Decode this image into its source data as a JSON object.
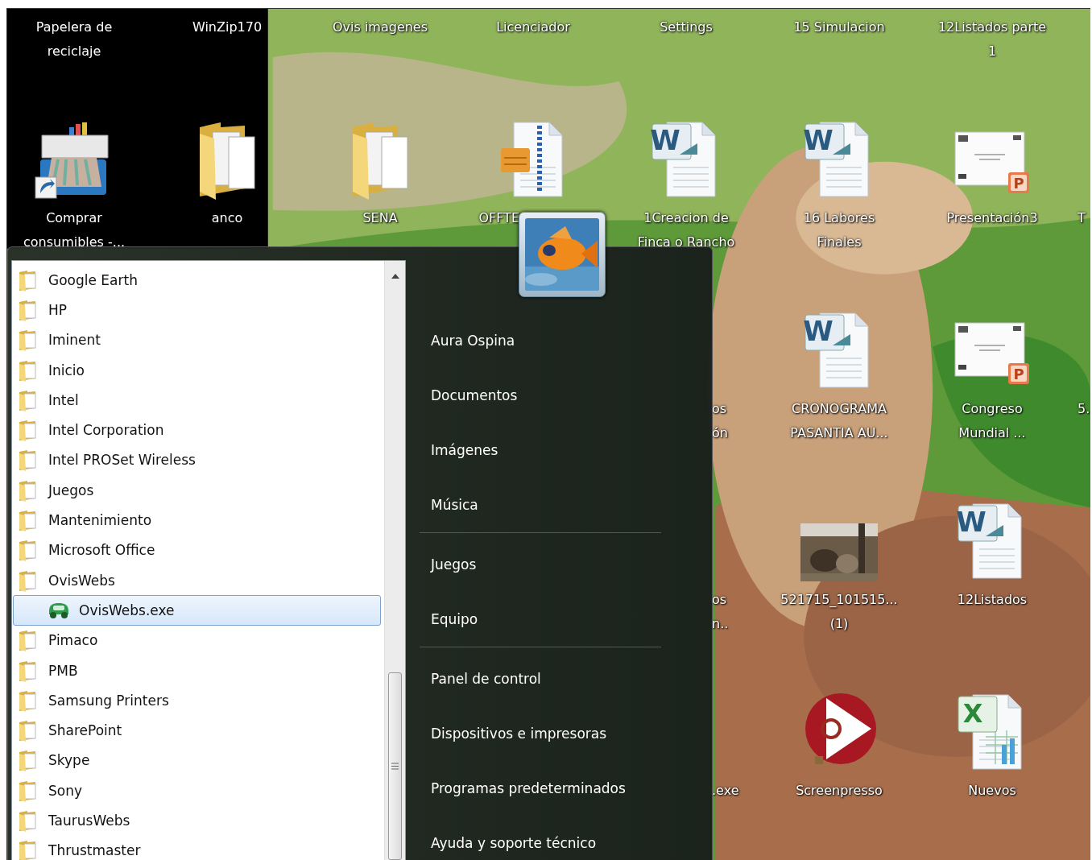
{
  "desktop": {
    "rows": [
      {
        "icons": [
          {
            "label": "Papelera de\nreciclaje",
            "kind": "none",
            "cut": false
          },
          {
            "label": "WinZip170",
            "kind": "none",
            "cut": false
          },
          {
            "label": "Ovis imagenes",
            "kind": "none",
            "cut": false
          },
          {
            "label": "Licenciador",
            "kind": "none",
            "cut": false
          },
          {
            "label": "Settings",
            "kind": "none",
            "cut": false
          },
          {
            "label": "15 Simulacion",
            "kind": "none",
            "cut": false
          },
          {
            "label": "12Listados parte\n1",
            "kind": "none",
            "cut": false
          }
        ]
      },
      {
        "icons": [
          {
            "label": "Comprar\nconsumibles -...",
            "kind": "printer",
            "cut": false
          },
          {
            "label": "anco",
            "kind": "folder",
            "cut": false
          },
          {
            "label": "SENA",
            "kind": "folder",
            "cut": false
          },
          {
            "label": "OFFTE",
            "kind": "archive",
            "cut": true
          },
          {
            "label": "1Creacion de\nFinca o Rancho",
            "kind": "word",
            "badge": "W",
            "cut": false
          },
          {
            "label": "16 Labores\nFinales",
            "kind": "word",
            "badge": "W",
            "cut": false
          },
          {
            "label": "Presentación3",
            "kind": "powerpoint",
            "badge": "P",
            "cut": false
          },
          {
            "label": "T",
            "kind": "none",
            "cut": true
          }
        ]
      },
      {
        "icons": [
          {
            "label": "os\nón",
            "kind": "none",
            "cut": true
          },
          {
            "label": "CRONOGRAMA\nPASANTIA AU...",
            "kind": "word",
            "badge": "W",
            "cut": false
          },
          {
            "label": "Congreso\nMundial ...",
            "kind": "powerpoint",
            "badge": "P",
            "cut": false
          },
          {
            "label": "5.",
            "kind": "none",
            "cut": true
          }
        ]
      },
      {
        "icons": [
          {
            "label": "os\nn..",
            "kind": "none",
            "cut": true
          },
          {
            "label": "521715_101515...\n(1)",
            "cut": false
          },
          {
            "label": "12Listados",
            "kind": "word",
            "badge": "W",
            "cut": false
          }
        ]
      },
      {
        "icons": [
          {
            "label": ".exe",
            "kind": "none",
            "cut": true
          },
          {
            "label": "Screenpresso",
            "kind": "play",
            "cut": false
          },
          {
            "label": "Nuevos",
            "kind": "excel",
            "badge": "X",
            "cut": false
          }
        ]
      }
    ]
  },
  "start_menu": {
    "programs": [
      {
        "label": "Google Earth",
        "kind": "folder",
        "selected": false
      },
      {
        "label": "HP",
        "kind": "folder",
        "selected": false
      },
      {
        "label": "Iminent",
        "kind": "folder",
        "selected": false
      },
      {
        "label": "Inicio",
        "kind": "folder",
        "selected": false
      },
      {
        "label": "Intel",
        "kind": "folder",
        "selected": false
      },
      {
        "label": "Intel Corporation",
        "kind": "folder",
        "selected": false
      },
      {
        "label": "Intel PROSet Wireless",
        "kind": "folder",
        "selected": false
      },
      {
        "label": "Juegos",
        "kind": "folder",
        "selected": false
      },
      {
        "label": "Mantenimiento",
        "kind": "folder",
        "selected": false
      },
      {
        "label": "Microsoft Office",
        "kind": "folder",
        "selected": false
      },
      {
        "label": "OvisWebs",
        "kind": "folder",
        "selected": false,
        "children": [
          {
            "label": "OvisWebs.exe",
            "kind": "program",
            "selected": true
          }
        ]
      },
      {
        "label": "Pimaco",
        "kind": "folder",
        "selected": false
      },
      {
        "label": "PMB",
        "kind": "folder",
        "selected": false
      },
      {
        "label": "Samsung Printers",
        "kind": "folder",
        "selected": false
      },
      {
        "label": "SharePoint",
        "kind": "folder",
        "selected": false
      },
      {
        "label": "Skype",
        "kind": "folder",
        "selected": false
      },
      {
        "label": "Sony",
        "kind": "folder",
        "selected": false
      },
      {
        "label": "TaurusWebs",
        "kind": "folder",
        "selected": false
      },
      {
        "label": "Thrustmaster",
        "kind": "folder",
        "selected": false
      }
    ],
    "groups": [
      {
        "items": [
          "Aura Ospina",
          "Documentos",
          "Imágenes",
          "Música"
        ]
      },
      {
        "items": [
          "Juegos",
          "Equipo"
        ]
      },
      {
        "items": [
          "Panel de control",
          "Dispositivos e impresoras",
          "Programas predeterminados",
          "Ayuda y soporte técnico"
        ]
      }
    ]
  }
}
